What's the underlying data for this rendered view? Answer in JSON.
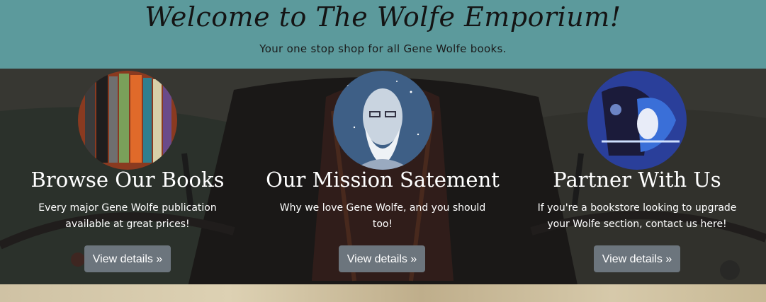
{
  "header": {
    "title": "Welcome to The Wolfe Emporium!",
    "tagline": "Your one stop shop for all Gene Wolfe books."
  },
  "features": [
    {
      "image": "bookshelf-photo",
      "title": "Browse Our Books",
      "description": "Every major Gene Wolfe publication available at great prices!",
      "button": "View details »"
    },
    {
      "image": "gene-wolfe-portrait",
      "title": "Our Mission Satement",
      "description": "Why we love Gene Wolfe, and you should too!",
      "button": "View details »"
    },
    {
      "image": "illustration-art",
      "title": "Partner With Us",
      "description": "If you're a bookstore looking to upgrade your Wolfe section, contact us here!",
      "button": "View details »"
    }
  ],
  "colors": {
    "header_bg": "#5c9a9c",
    "button_bg": "#6c757d",
    "text_light": "#ffffff"
  }
}
